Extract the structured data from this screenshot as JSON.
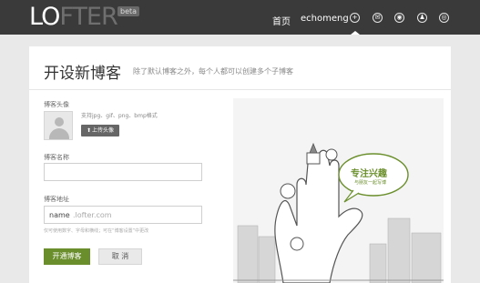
{
  "header": {
    "logo_main": "LO",
    "logo_accent": "FTER",
    "beta": "beta",
    "nav": {
      "home": "首页",
      "user": "echomeng"
    },
    "icons": [
      "plus-icon",
      "mail-icon",
      "compass-icon",
      "people-icon",
      "settings-icon"
    ],
    "colors": {
      "bar": "#3a3a3a"
    }
  },
  "form": {
    "title": "开设新博客",
    "subtitle": "除了默认博客之外，每个人都可以创建多个子博客",
    "avatar": {
      "label": "博客头像",
      "formats": "支持jpg、gif、png、bmp格式",
      "upload_label": "上传头像"
    },
    "name": {
      "label": "博客名称",
      "value": ""
    },
    "address": {
      "label": "博客地址",
      "prefix": "name",
      "suffix": ".lofter.com",
      "hint": "仅可使用数字、字母和横线；可在“博客设置”中更改"
    },
    "buttons": {
      "open": "开通博客",
      "cancel": "取 消"
    },
    "colors": {
      "accent": "#6a8e2b"
    }
  },
  "illustration": {
    "bubble_main": "专注兴趣",
    "bubble_sub": "与朋友一起写博"
  }
}
